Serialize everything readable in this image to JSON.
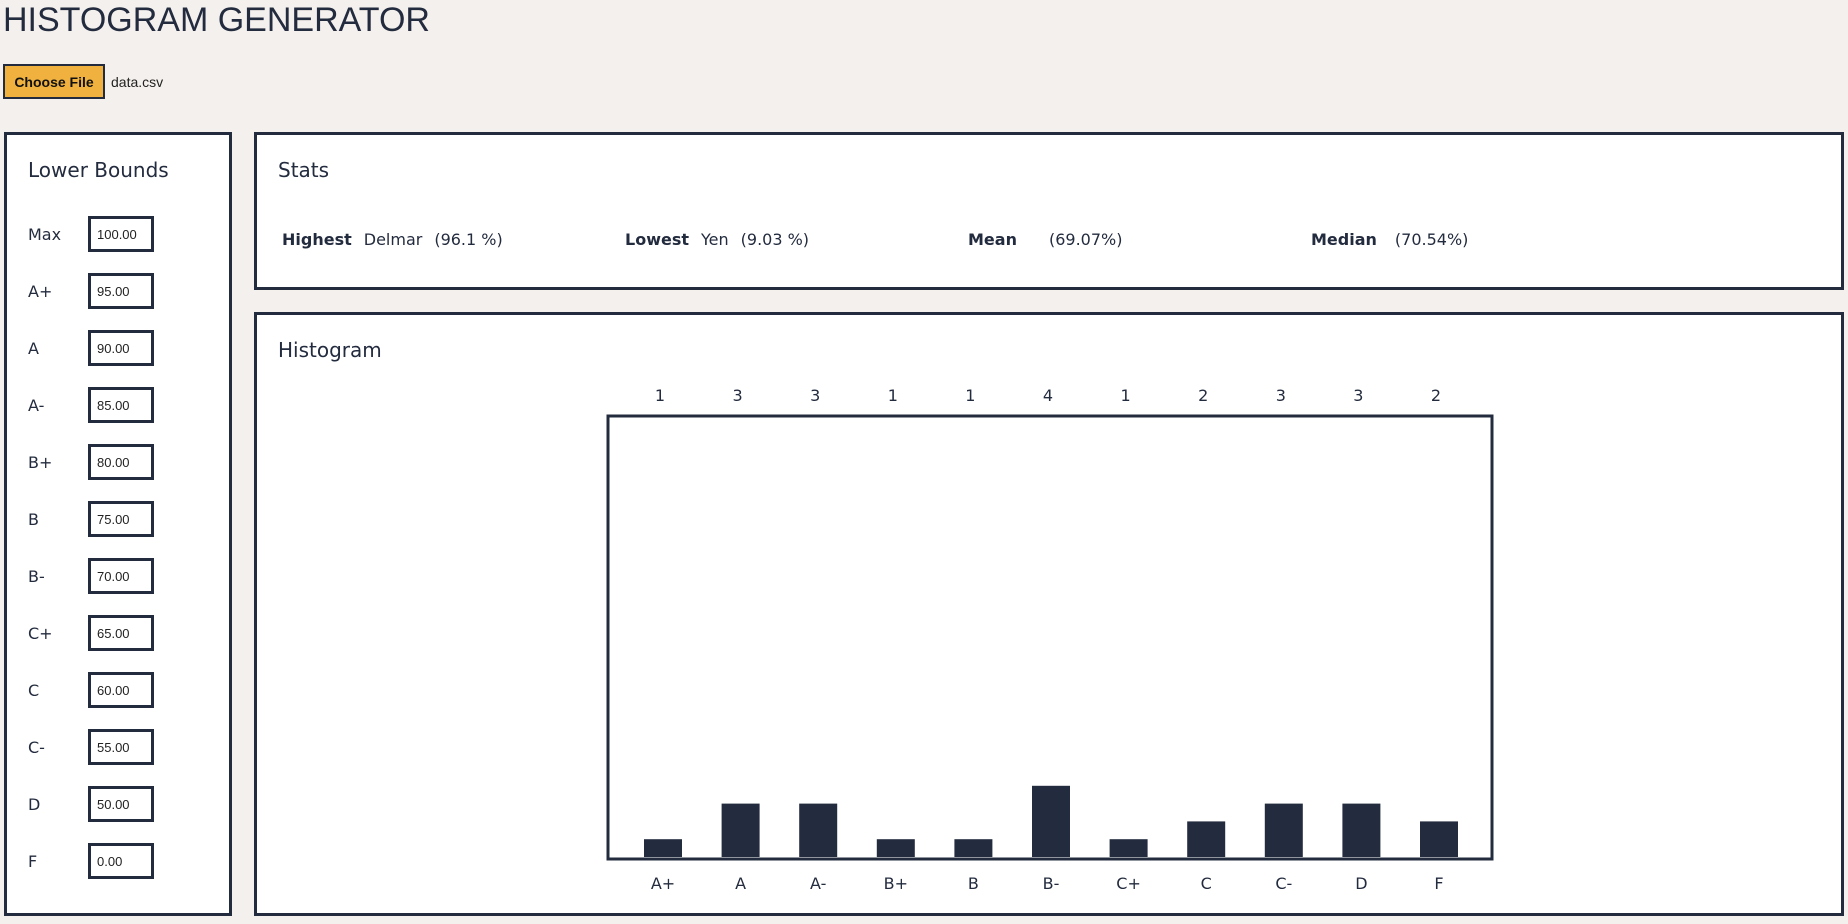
{
  "app": {
    "title": "HISTOGRAM GENERATOR"
  },
  "file": {
    "button_label": "Choose File",
    "file_name": "data.csv"
  },
  "bounds": {
    "title": "Lower Bounds",
    "rows": [
      {
        "label": "Max",
        "value": "100.00"
      },
      {
        "label": "A+",
        "value": "95.00"
      },
      {
        "label": "A",
        "value": "90.00"
      },
      {
        "label": "A-",
        "value": "85.00"
      },
      {
        "label": "B+",
        "value": "80.00"
      },
      {
        "label": "B",
        "value": "75.00"
      },
      {
        "label": "B-",
        "value": "70.00"
      },
      {
        "label": "C+",
        "value": "65.00"
      },
      {
        "label": "C",
        "value": "60.00"
      },
      {
        "label": "C-",
        "value": "55.00"
      },
      {
        "label": "D",
        "value": "50.00"
      },
      {
        "label": "F",
        "value": "0.00"
      }
    ]
  },
  "stats": {
    "title": "Stats",
    "highest": {
      "label": "Highest",
      "name": "Delmar",
      "value": "(96.1 %)"
    },
    "lowest": {
      "label": "Lowest",
      "name": "Yen",
      "value": "(9.03 %)"
    },
    "mean": {
      "label": "Mean",
      "value": "(69.07%)"
    },
    "median": {
      "label": "Median",
      "value": "(70.54%)"
    }
  },
  "histogram": {
    "title": "Histogram"
  },
  "chart_data": {
    "type": "bar",
    "categories": [
      "A+",
      "A",
      "A-",
      "B+",
      "B",
      "B-",
      "C+",
      "C",
      "C-",
      "D",
      "F"
    ],
    "values": [
      1,
      3,
      3,
      1,
      1,
      4,
      1,
      2,
      3,
      3,
      2
    ],
    "title": "",
    "xlabel": "",
    "ylabel": "",
    "grid": false
  },
  "colors": {
    "bar": "#232b3e",
    "accent": "#f0b13e",
    "background": "#f4f0ed"
  }
}
